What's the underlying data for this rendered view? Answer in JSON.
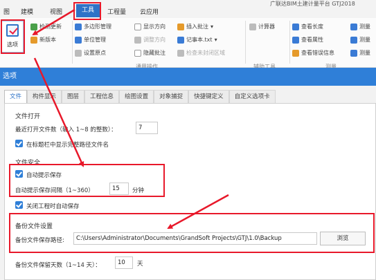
{
  "window": {
    "title": "广联达BIM土建计量平台 GTJ2018"
  },
  "menu_tabs": [
    "图",
    "建模",
    "视图",
    "工具",
    "工程量",
    "云应用"
  ],
  "ribbon": {
    "options_label": "选项",
    "check_update": "检测更新",
    "new_version": "新版本",
    "poly_manage": "多边形管理",
    "unit_manage": "单位管理",
    "set_origin": "设置原点",
    "show_direction": "显示方向",
    "adjust_direction": "调整方向",
    "hide_annotation": "隐藏批注",
    "insert_annotation": "插入批注",
    "notepad": "记事本.txt",
    "check_unclosed": "检查未封闭区域",
    "calculator": "计算器",
    "view_length": "查看长度",
    "view_attributes": "查看属性",
    "view_error_info": "查看错误信息",
    "measure": "测量",
    "group_common": "通用操作",
    "group_aux": "辅助工具",
    "group_measure": "测量"
  },
  "dialog": {
    "title": "选项",
    "tabs": [
      "文件",
      "构件显示",
      "图层",
      "工程信息",
      "绘图设置",
      "对象捕捉",
      "快捷键定义",
      "自定义选项卡"
    ],
    "active_tab": "文件",
    "file_open": {
      "section": "文件打开",
      "recent_label": "最近打开文件数（输入 1~8 的整数）：",
      "recent_value": "7",
      "show_full_path": "在标题栏中显示完整路径文件名"
    },
    "file_safety": {
      "section": "文件安全",
      "auto_save_reminder": "自动提示保存",
      "interval_label": "自动提示保存间隔（1~360）",
      "interval_value": "15",
      "interval_unit": "分钟",
      "auto_save_on_close": "关闭工程时自动保存"
    },
    "backup": {
      "section": "备份文件设置",
      "path_label": "备份文件保存路径:",
      "path_value": "C:\\Users\\Administrator\\Documents\\GrandSoft Projects\\GTJ\\1.0\\Backup",
      "browse_label": "浏览",
      "days_label": "备份文件保留天数（1~14 天）：",
      "days_value": "10",
      "days_unit": "天"
    }
  },
  "colors": {
    "accent": "#2f7fd8",
    "annotation_red": "#e8182a"
  }
}
